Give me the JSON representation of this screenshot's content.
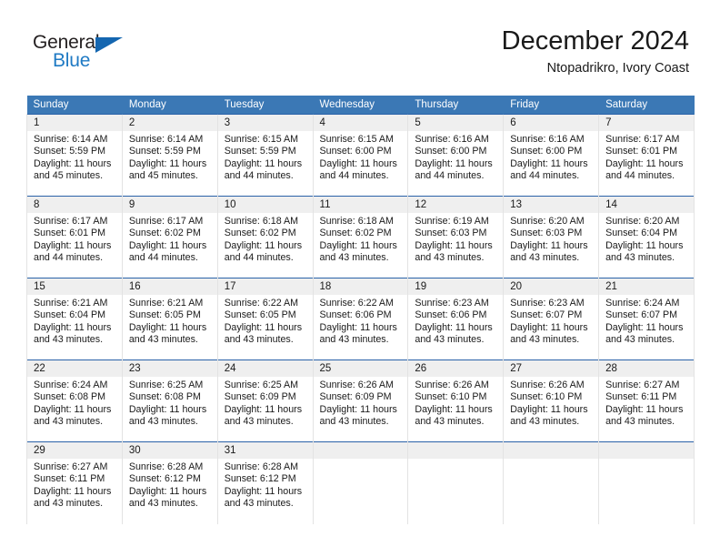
{
  "brand": {
    "name_top": "General",
    "name_bottom": "Blue",
    "accent_color": "#1466b0",
    "text_color": "#231f20"
  },
  "header": {
    "title": "December 2024",
    "subtitle": "Ntopadrikro, Ivory Coast"
  },
  "calendar": {
    "header_bg": "#3b78b5",
    "daynum_bg": "#efefef",
    "weekday_headers": [
      "Sunday",
      "Monday",
      "Tuesday",
      "Wednesday",
      "Thursday",
      "Friday",
      "Saturday"
    ],
    "weeks": [
      [
        {
          "day": "1",
          "sunrise": "Sunrise: 6:14 AM",
          "sunset": "Sunset: 5:59 PM",
          "daylight_1": "Daylight: 11 hours",
          "daylight_2": "and 45 minutes."
        },
        {
          "day": "2",
          "sunrise": "Sunrise: 6:14 AM",
          "sunset": "Sunset: 5:59 PM",
          "daylight_1": "Daylight: 11 hours",
          "daylight_2": "and 45 minutes."
        },
        {
          "day": "3",
          "sunrise": "Sunrise: 6:15 AM",
          "sunset": "Sunset: 5:59 PM",
          "daylight_1": "Daylight: 11 hours",
          "daylight_2": "and 44 minutes."
        },
        {
          "day": "4",
          "sunrise": "Sunrise: 6:15 AM",
          "sunset": "Sunset: 6:00 PM",
          "daylight_1": "Daylight: 11 hours",
          "daylight_2": "and 44 minutes."
        },
        {
          "day": "5",
          "sunrise": "Sunrise: 6:16 AM",
          "sunset": "Sunset: 6:00 PM",
          "daylight_1": "Daylight: 11 hours",
          "daylight_2": "and 44 minutes."
        },
        {
          "day": "6",
          "sunrise": "Sunrise: 6:16 AM",
          "sunset": "Sunset: 6:00 PM",
          "daylight_1": "Daylight: 11 hours",
          "daylight_2": "and 44 minutes."
        },
        {
          "day": "7",
          "sunrise": "Sunrise: 6:17 AM",
          "sunset": "Sunset: 6:01 PM",
          "daylight_1": "Daylight: 11 hours",
          "daylight_2": "and 44 minutes."
        }
      ],
      [
        {
          "day": "8",
          "sunrise": "Sunrise: 6:17 AM",
          "sunset": "Sunset: 6:01 PM",
          "daylight_1": "Daylight: 11 hours",
          "daylight_2": "and 44 minutes."
        },
        {
          "day": "9",
          "sunrise": "Sunrise: 6:17 AM",
          "sunset": "Sunset: 6:02 PM",
          "daylight_1": "Daylight: 11 hours",
          "daylight_2": "and 44 minutes."
        },
        {
          "day": "10",
          "sunrise": "Sunrise: 6:18 AM",
          "sunset": "Sunset: 6:02 PM",
          "daylight_1": "Daylight: 11 hours",
          "daylight_2": "and 44 minutes."
        },
        {
          "day": "11",
          "sunrise": "Sunrise: 6:18 AM",
          "sunset": "Sunset: 6:02 PM",
          "daylight_1": "Daylight: 11 hours",
          "daylight_2": "and 43 minutes."
        },
        {
          "day": "12",
          "sunrise": "Sunrise: 6:19 AM",
          "sunset": "Sunset: 6:03 PM",
          "daylight_1": "Daylight: 11 hours",
          "daylight_2": "and 43 minutes."
        },
        {
          "day": "13",
          "sunrise": "Sunrise: 6:20 AM",
          "sunset": "Sunset: 6:03 PM",
          "daylight_1": "Daylight: 11 hours",
          "daylight_2": "and 43 minutes."
        },
        {
          "day": "14",
          "sunrise": "Sunrise: 6:20 AM",
          "sunset": "Sunset: 6:04 PM",
          "daylight_1": "Daylight: 11 hours",
          "daylight_2": "and 43 minutes."
        }
      ],
      [
        {
          "day": "15",
          "sunrise": "Sunrise: 6:21 AM",
          "sunset": "Sunset: 6:04 PM",
          "daylight_1": "Daylight: 11 hours",
          "daylight_2": "and 43 minutes."
        },
        {
          "day": "16",
          "sunrise": "Sunrise: 6:21 AM",
          "sunset": "Sunset: 6:05 PM",
          "daylight_1": "Daylight: 11 hours",
          "daylight_2": "and 43 minutes."
        },
        {
          "day": "17",
          "sunrise": "Sunrise: 6:22 AM",
          "sunset": "Sunset: 6:05 PM",
          "daylight_1": "Daylight: 11 hours",
          "daylight_2": "and 43 minutes."
        },
        {
          "day": "18",
          "sunrise": "Sunrise: 6:22 AM",
          "sunset": "Sunset: 6:06 PM",
          "daylight_1": "Daylight: 11 hours",
          "daylight_2": "and 43 minutes."
        },
        {
          "day": "19",
          "sunrise": "Sunrise: 6:23 AM",
          "sunset": "Sunset: 6:06 PM",
          "daylight_1": "Daylight: 11 hours",
          "daylight_2": "and 43 minutes."
        },
        {
          "day": "20",
          "sunrise": "Sunrise: 6:23 AM",
          "sunset": "Sunset: 6:07 PM",
          "daylight_1": "Daylight: 11 hours",
          "daylight_2": "and 43 minutes."
        },
        {
          "day": "21",
          "sunrise": "Sunrise: 6:24 AM",
          "sunset": "Sunset: 6:07 PM",
          "daylight_1": "Daylight: 11 hours",
          "daylight_2": "and 43 minutes."
        }
      ],
      [
        {
          "day": "22",
          "sunrise": "Sunrise: 6:24 AM",
          "sunset": "Sunset: 6:08 PM",
          "daylight_1": "Daylight: 11 hours",
          "daylight_2": "and 43 minutes."
        },
        {
          "day": "23",
          "sunrise": "Sunrise: 6:25 AM",
          "sunset": "Sunset: 6:08 PM",
          "daylight_1": "Daylight: 11 hours",
          "daylight_2": "and 43 minutes."
        },
        {
          "day": "24",
          "sunrise": "Sunrise: 6:25 AM",
          "sunset": "Sunset: 6:09 PM",
          "daylight_1": "Daylight: 11 hours",
          "daylight_2": "and 43 minutes."
        },
        {
          "day": "25",
          "sunrise": "Sunrise: 6:26 AM",
          "sunset": "Sunset: 6:09 PM",
          "daylight_1": "Daylight: 11 hours",
          "daylight_2": "and 43 minutes."
        },
        {
          "day": "26",
          "sunrise": "Sunrise: 6:26 AM",
          "sunset": "Sunset: 6:10 PM",
          "daylight_1": "Daylight: 11 hours",
          "daylight_2": "and 43 minutes."
        },
        {
          "day": "27",
          "sunrise": "Sunrise: 6:26 AM",
          "sunset": "Sunset: 6:10 PM",
          "daylight_1": "Daylight: 11 hours",
          "daylight_2": "and 43 minutes."
        },
        {
          "day": "28",
          "sunrise": "Sunrise: 6:27 AM",
          "sunset": "Sunset: 6:11 PM",
          "daylight_1": "Daylight: 11 hours",
          "daylight_2": "and 43 minutes."
        }
      ],
      [
        {
          "day": "29",
          "sunrise": "Sunrise: 6:27 AM",
          "sunset": "Sunset: 6:11 PM",
          "daylight_1": "Daylight: 11 hours",
          "daylight_2": "and 43 minutes."
        },
        {
          "day": "30",
          "sunrise": "Sunrise: 6:28 AM",
          "sunset": "Sunset: 6:12 PM",
          "daylight_1": "Daylight: 11 hours",
          "daylight_2": "and 43 minutes."
        },
        {
          "day": "31",
          "sunrise": "Sunrise: 6:28 AM",
          "sunset": "Sunset: 6:12 PM",
          "daylight_1": "Daylight: 11 hours",
          "daylight_2": "and 43 minutes."
        },
        {
          "day": "",
          "sunrise": "",
          "sunset": "",
          "daylight_1": "",
          "daylight_2": ""
        },
        {
          "day": "",
          "sunrise": "",
          "sunset": "",
          "daylight_1": "",
          "daylight_2": ""
        },
        {
          "day": "",
          "sunrise": "",
          "sunset": "",
          "daylight_1": "",
          "daylight_2": ""
        },
        {
          "day": "",
          "sunrise": "",
          "sunset": "",
          "daylight_1": "",
          "daylight_2": ""
        }
      ]
    ]
  }
}
